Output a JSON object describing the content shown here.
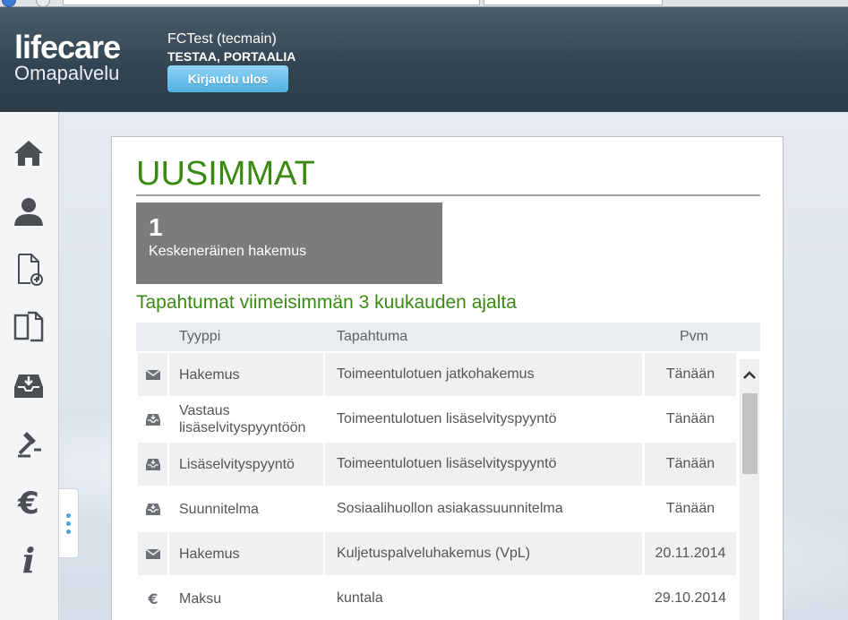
{
  "app": {
    "brand": "lifecare",
    "subtitle": "Omapalvelu"
  },
  "user": {
    "name": "FCTest (tecmain)",
    "organization": "TESTAA, PORTAALIA",
    "logout_label": "Kirjaudu ulos"
  },
  "sidebar": {
    "items": [
      {
        "icon": "home-icon"
      },
      {
        "icon": "user-icon"
      },
      {
        "icon": "new-document-icon"
      },
      {
        "icon": "documents-icon"
      },
      {
        "icon": "inbox-icon"
      },
      {
        "icon": "gavel-icon"
      },
      {
        "icon": "euro-icon"
      },
      {
        "icon": "info-icon"
      }
    ]
  },
  "main": {
    "title": "UUSIMMAT",
    "tile": {
      "count": "1",
      "label": "Keskeneräinen hakemus"
    },
    "events_title": "Tapahtumat viimeisimmän 3 kuukauden ajalta",
    "table": {
      "headers": {
        "type": "Tyyppi",
        "event": "Tapahtuma",
        "date": "Pvm"
      },
      "rows": [
        {
          "icon": "mail-icon",
          "type": "Hakemus",
          "event": "Toimeentulotuen jatkohakemus",
          "date": "Tänään"
        },
        {
          "icon": "inbox-tray-icon",
          "type": "Vastaus lisäselvityspyyntöön",
          "event": "Toimeentulotuen lisäselvityspyyntö",
          "date": "Tänään"
        },
        {
          "icon": "inbox-tray-icon",
          "type": "Lisäselvityspyyntö",
          "event": "Toimeentulotuen lisäselvityspyyntö",
          "date": "Tänään"
        },
        {
          "icon": "inbox-tray-icon",
          "type": "Suunnitelma",
          "event": "Sosiaalihuollon asiakassuunnitelma",
          "date": "Tänään"
        },
        {
          "icon": "mail-icon",
          "type": "Hakemus",
          "event": "Kuljetuspalveluhakemus (VpL)",
          "date": "20.11.2014"
        },
        {
          "icon": "euro-icon",
          "type": "Maksu",
          "event": "kuntala",
          "date": "29.10.2014"
        }
      ]
    }
  },
  "colors": {
    "accent_green": "#3a8a12",
    "header_dark": "#334552",
    "logout_blue": "#4fb1e2",
    "tile_gray": "#7d7b7b"
  }
}
